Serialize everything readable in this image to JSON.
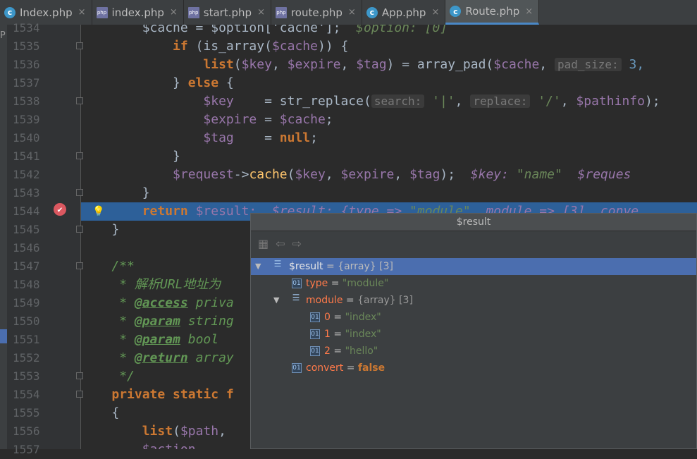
{
  "tabs": [
    {
      "label": "Index.php",
      "icon": "class-icon",
      "active": false
    },
    {
      "label": "index.php",
      "icon": "php-file-icon",
      "active": false
    },
    {
      "label": "start.php",
      "icon": "php-file-icon",
      "active": false
    },
    {
      "label": "route.php",
      "icon": "php-file-icon",
      "active": false
    },
    {
      "label": "App.php",
      "icon": "class-icon",
      "active": false
    },
    {
      "label": "Route.php",
      "icon": "class-icon",
      "active": true
    }
  ],
  "tab_close_glyph": "×",
  "gutter": {
    "line_numbers": [
      "1534",
      "1535",
      "1536",
      "1537",
      "1538",
      "1539",
      "1540",
      "1541",
      "1542",
      "1543",
      "1544",
      "1545",
      "1546",
      "1547",
      "1548",
      "1549",
      "1550",
      "1551",
      "1552",
      "1553",
      "1554",
      "1555",
      "1556",
      "1557"
    ],
    "current_line": "1544"
  },
  "left_strip": {
    "label": "P"
  },
  "code": {
    "l1534": {
      "a": "        $cache = $option['cache'];",
      "hint": "  $option: [0]"
    },
    "l1535": {
      "kw": "if",
      "rest": " (is_array(",
      "v": "$cache",
      "end": ")) {"
    },
    "l1536": {
      "kw": "list",
      "p1": "(",
      "v1": "$key",
      ",": ", ",
      "v2": "$expire",
      ",2": ", ",
      "v3": "$tag",
      "p2": ") = array_pad(",
      "v4": "$cache",
      ",3": ", ",
      "hint": "pad_size:",
      "num": " 3,"
    },
    "l1537": {
      "a": "} ",
      "kw": "else",
      "b": " {"
    },
    "l1538": {
      "v1": "$key",
      "a": "    = str_replace(",
      "hint1": "search:",
      "s1": " '|'",
      ",": ", ",
      "hint2": "replace:",
      "s2": " '/'",
      ",2": ", ",
      "v2": "$pathinfo",
      ")": ");"
    },
    "l1539": {
      "v1": "$expire",
      "a": " = ",
      "v2": "$cache",
      ";": ";"
    },
    "l1540": {
      "v1": "$tag",
      "a": "    = ",
      "kw": "null",
      ";": ";"
    },
    "l1541": {
      "a": "}"
    },
    "l1542": {
      "v1": "$request",
      "a": "->",
      "fn": "cache",
      "p": "(",
      "v2": "$key",
      ",": ", ",
      "v3": "$expire",
      ",2": ", ",
      "v4": "$tag",
      ")": ");",
      "hint1": "  $key: ",
      "s1": "\"name\"",
      "hint2": "  $reques"
    },
    "l1543": {
      "a": "}"
    },
    "l1544": {
      "kw": "return",
      "v": " $result;",
      "inl1": "  $result: {type => ",
      "s1": "\"module\"",
      "inl2": ", module => [3], conve"
    },
    "l1545": {
      "a": "}"
    },
    "l1546": {
      "a": ""
    },
    "l1547": {
      "a": "/**"
    },
    "l1548": {
      "a": " * 解析URL地址为"
    },
    "l1549": {
      "a": " * ",
      "tag": "@access",
      "b": " priva"
    },
    "l1550": {
      "a": " * ",
      "tag": "@param",
      "b": " string"
    },
    "l1551": {
      "a": " * ",
      "tag": "@param",
      "b": " bool"
    },
    "l1552": {
      "a": " * ",
      "tag": "@return",
      "b": " array"
    },
    "l1553": {
      "a": " */"
    },
    "l1554": {
      "kw": "private static f"
    },
    "l1555": {
      "a": "{"
    },
    "l1556": {
      "kw": "list",
      "p": "(",
      "v": "$path",
      ",": ","
    },
    "l1557": {
      "v": "$action"
    }
  },
  "debug_popup": {
    "title": "$result",
    "toolbar_icons": [
      "pin-icon",
      "back-icon",
      "forward-icon"
    ],
    "nodes": [
      {
        "name": "$result",
        "eq": " = ",
        "type": "{array} [3]",
        "value": "",
        "expanded": true,
        "selected": true
      },
      {
        "name": "type",
        "eq": " = ",
        "type": "",
        "value": "\"module\""
      },
      {
        "name": "module",
        "eq": " = ",
        "type": "{array} [3]",
        "value": "",
        "expanded": true
      },
      {
        "name": "0",
        "eq": " = ",
        "type": "",
        "value": "\"index\""
      },
      {
        "name": "1",
        "eq": " = ",
        "type": "",
        "value": "\"index\""
      },
      {
        "name": "2",
        "eq": " = ",
        "type": "",
        "value": "\"hello\""
      },
      {
        "name": "convert",
        "eq": " = ",
        "type": "",
        "value": "false"
      }
    ]
  },
  "colors": {
    "keyword": "#cc7832",
    "variable": "#9876aa",
    "string": "#6a8759",
    "selection": "#4b6eaf",
    "exec_line": "#2d6099"
  }
}
